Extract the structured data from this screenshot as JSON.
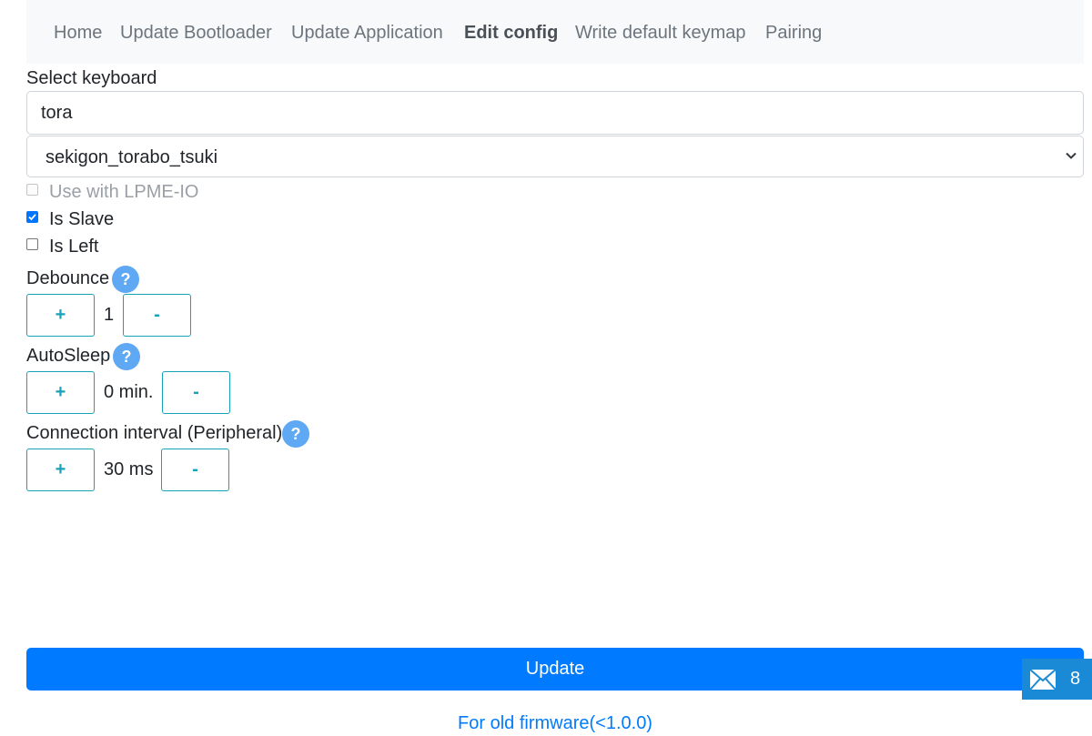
{
  "nav": {
    "items": [
      {
        "label": "Home"
      },
      {
        "label": "Update Bootloader"
      },
      {
        "label": "Update Application"
      },
      {
        "label": "Edit config"
      },
      {
        "label": "Write default keymap"
      },
      {
        "label": "Pairing"
      }
    ],
    "active": "Edit config"
  },
  "keyboard": {
    "label": "Select keyboard",
    "search_value": "tora",
    "selected": "sekigon_torabo_tsuki"
  },
  "options": {
    "lpme": {
      "label": "Use with LPME-IO",
      "checked": false,
      "disabled": true
    },
    "slave": {
      "label": "Is Slave",
      "checked": true
    },
    "left": {
      "label": "Is Left",
      "checked": false
    }
  },
  "debounce": {
    "label": "Debounce",
    "value": "1",
    "plus": "+",
    "minus": "-",
    "help": "?"
  },
  "autosleep": {
    "label": "AutoSleep",
    "value": "0 min.",
    "plus": "+",
    "minus": "-",
    "help": "?"
  },
  "interval": {
    "label": "Connection interval (Peripheral)",
    "value": "30 ms",
    "plus": "+",
    "minus": "-",
    "help": "?"
  },
  "actions": {
    "update": "Update",
    "old_firmware": "For old firmware(<1.0.0)"
  },
  "widget": {
    "count": "8"
  },
  "colors": {
    "primary": "#007bff",
    "info": "#17a2b8",
    "help": "#5ea8f4",
    "nav_bg": "#f8f9fa"
  }
}
